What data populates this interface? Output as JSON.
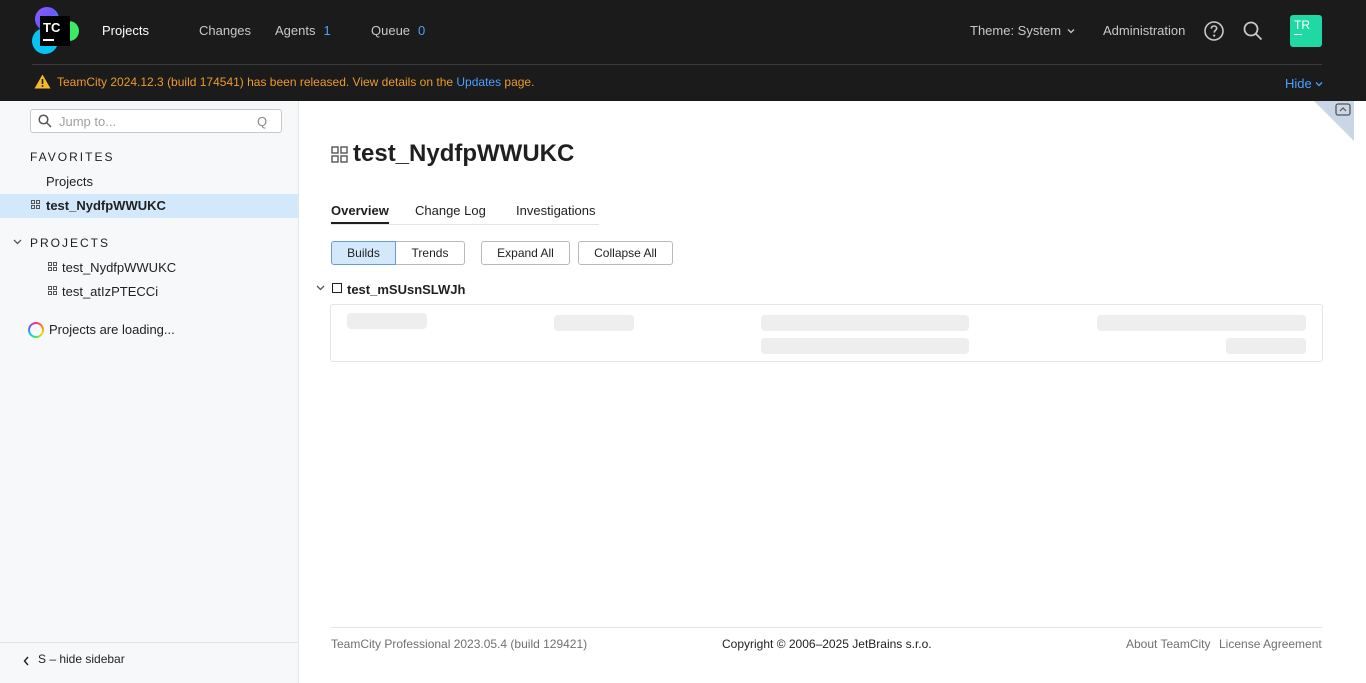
{
  "header": {
    "nav": {
      "projects": "Projects",
      "changes": "Changes",
      "agents": "Agents",
      "agents_count": "1",
      "queue": "Queue",
      "queue_count": "0"
    },
    "theme": "Theme: System",
    "administration": "Administration",
    "avatar_initials": "TR",
    "banner": {
      "text_before": "TeamCity 2024.12.3 (build 174541) has been released. View details on the ",
      "link": "Updates",
      "text_after": " page.",
      "hide": "Hide"
    }
  },
  "sidebar": {
    "search_placeholder": "Jump to...",
    "search_shortcut": "Q",
    "favorites_title": "FAVORITES",
    "favorites": [
      "Projects",
      "test_NydfpWWUKC"
    ],
    "projects_title": "PROJECTS",
    "projects": [
      "test_NydfpWWUKC",
      "test_atIzPTECCi"
    ],
    "loading": "Projects are loading...",
    "hide_sidebar": "S – hide sidebar"
  },
  "main": {
    "title": "test_NydfpWWUKC",
    "tabs": [
      "Overview",
      "Change Log",
      "Investigations"
    ],
    "view_buttons": [
      "Builds",
      "Trends"
    ],
    "expand_all": "Expand All",
    "collapse_all": "Collapse All",
    "build_config": "test_mSUsnSLWJh"
  },
  "footer": {
    "version": "TeamCity Professional 2023.05.4 (build 129421)",
    "copyright": "Copyright © 2006–2025 JetBrains s.r.o.",
    "about": "About TeamCity",
    "license": "License Agreement"
  },
  "colors": {
    "header_bg": "#1b1b1c",
    "accent_link": "#4b9fff",
    "warning": "#ec9a28",
    "avatar_bg": "#1fd8a4",
    "selected_bg": "#d4e8fb"
  }
}
